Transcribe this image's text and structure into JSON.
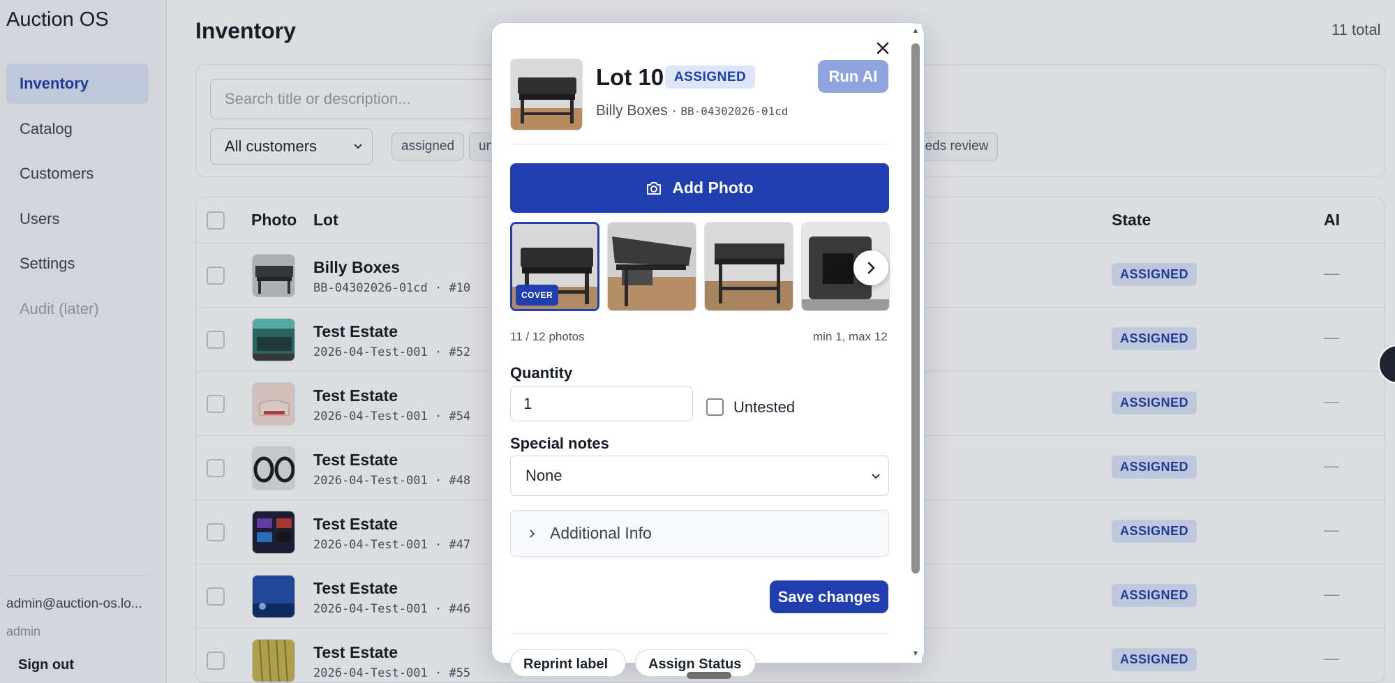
{
  "app": {
    "name": "Auction OS"
  },
  "sidebar": {
    "items": [
      {
        "label": "Inventory",
        "active": true
      },
      {
        "label": "Catalog"
      },
      {
        "label": "Customers"
      },
      {
        "label": "Users"
      },
      {
        "label": "Settings"
      },
      {
        "label": "Audit (later)",
        "disabled": true
      }
    ],
    "user_email": "admin@auction-os.lo...",
    "user_role": "admin",
    "signout_label": "Sign out"
  },
  "page": {
    "title": "Inventory",
    "total": "11 total"
  },
  "filters": {
    "search_placeholder": "Search title or description...",
    "customer_selected": "All customers",
    "chips": [
      "assigned",
      "un",
      "eeds review"
    ]
  },
  "table": {
    "headers": {
      "photo": "Photo",
      "lot": "Lot",
      "state": "State",
      "ai": "AI"
    },
    "rows": [
      {
        "title": "Billy Boxes",
        "sub": "BB-04302026-01cd · #10",
        "state": "ASSIGNED",
        "ai": "—"
      },
      {
        "title": "Test Estate",
        "sub": "2026-04-Test-001 · #52",
        "state": "ASSIGNED",
        "ai": "—"
      },
      {
        "title": "Test Estate",
        "sub": "2026-04-Test-001 · #54",
        "state": "ASSIGNED",
        "ai": "—"
      },
      {
        "title": "Test Estate",
        "sub": "2026-04-Test-001 · #48",
        "state": "ASSIGNED",
        "ai": "—"
      },
      {
        "title": "Test Estate",
        "sub": "2026-04-Test-001 · #47",
        "state": "ASSIGNED",
        "ai": "—"
      },
      {
        "title": "Test Estate",
        "sub": "2026-04-Test-001 · #46",
        "state": "ASSIGNED",
        "ai": "—"
      },
      {
        "title": "Test Estate",
        "sub": "2026-04-Test-001 · #55",
        "state": "ASSIGNED",
        "ai": "—"
      }
    ]
  },
  "modal": {
    "lot_title": "Lot 10",
    "state_badge": "ASSIGNED",
    "run_ai_label": "Run AI",
    "customer": "Billy Boxes",
    "separator": " · ",
    "code": "BB-04302026-01cd",
    "add_photo_label": "Add Photo",
    "cover_label": "COVER",
    "photo_count": "11 / 12 photos",
    "photo_limits": "min 1, max 12",
    "quantity_label": "Quantity",
    "quantity_value": "1",
    "untested_label": "Untested",
    "untested_checked": false,
    "special_notes_label": "Special notes",
    "special_notes_value": "None",
    "additional_info_label": "Additional Info",
    "save_label": "Save changes",
    "cut_buttons": [
      "Reprint label",
      "Assign Status"
    ]
  },
  "colors": {
    "primary": "#1f3fb0",
    "badge_bg": "#dde6f8",
    "badge_text": "#1c3fae",
    "run_ai_disabled": "#8fa3de"
  }
}
